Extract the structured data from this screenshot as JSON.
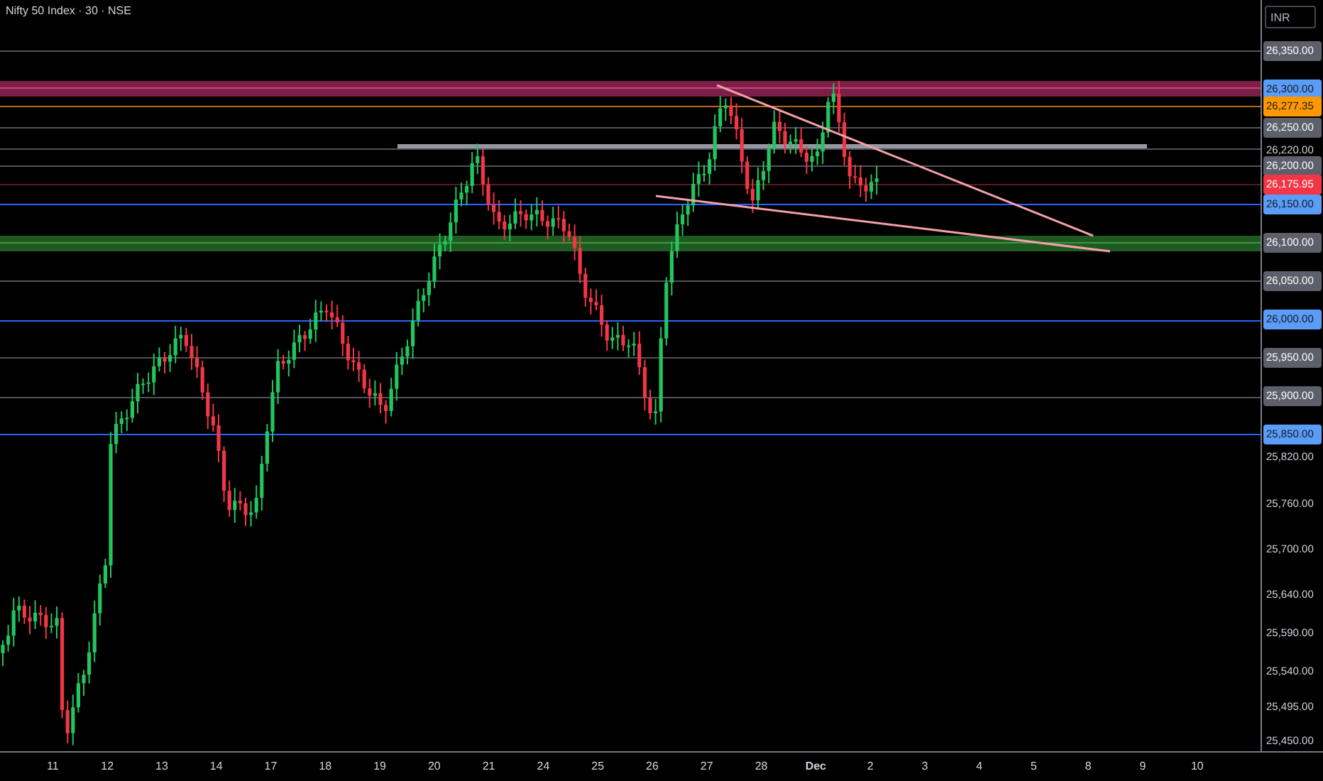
{
  "chart_header": {
    "title": "Nifty 50 Index · 30 · NSE"
  },
  "price_axis": {
    "currency": "INR",
    "labels": [
      {
        "text": "26,350.00",
        "kind": "tag",
        "color": "#5d606b"
      },
      {
        "text": "26,300.00",
        "kind": "tag",
        "color": "#5b9cf6"
      },
      {
        "text": "26,277.35",
        "kind": "tag",
        "color": "#ff9800"
      },
      {
        "text": "26,250.00",
        "kind": "tag",
        "color": "#5d606b"
      },
      {
        "text": "26,220.00",
        "kind": "plain"
      },
      {
        "text": "26,200.00",
        "kind": "tag",
        "color": "#5d606b"
      },
      {
        "text": "26,175.95",
        "kind": "tag",
        "color": "#f23645"
      },
      {
        "text": "26,150.00",
        "kind": "tag",
        "color": "#5b9cf6"
      },
      {
        "text": "26,100.00",
        "kind": "tag",
        "color": "#5d606b"
      },
      {
        "text": "26,050.00",
        "kind": "tag",
        "color": "#5d606b"
      },
      {
        "text": "26,000.00",
        "kind": "tag",
        "color": "#5b9cf6"
      },
      {
        "text": "25,950.00",
        "kind": "tag",
        "color": "#5d606b"
      },
      {
        "text": "25,900.00",
        "kind": "tag",
        "color": "#5d606b"
      },
      {
        "text": "25,850.00",
        "kind": "tag",
        "color": "#5b9cf6"
      },
      {
        "text": "25,820.00",
        "kind": "plain"
      },
      {
        "text": "25,760.00",
        "kind": "plain"
      },
      {
        "text": "25,700.00",
        "kind": "plain"
      },
      {
        "text": "25,640.00",
        "kind": "plain"
      },
      {
        "text": "25,590.00",
        "kind": "plain"
      },
      {
        "text": "25,540.00",
        "kind": "plain"
      },
      {
        "text": "25,495.00",
        "kind": "plain"
      },
      {
        "text": "25,450.00",
        "kind": "plain"
      }
    ]
  },
  "time_axis": {
    "labels": [
      {
        "text": "11",
        "kind": "day"
      },
      {
        "text": "12",
        "kind": "day"
      },
      {
        "text": "13",
        "kind": "day"
      },
      {
        "text": "14",
        "kind": "day"
      },
      {
        "text": "17",
        "kind": "day"
      },
      {
        "text": "18",
        "kind": "day"
      },
      {
        "text": "19",
        "kind": "day"
      },
      {
        "text": "20",
        "kind": "day"
      },
      {
        "text": "21",
        "kind": "day"
      },
      {
        "text": "24",
        "kind": "day"
      },
      {
        "text": "25",
        "kind": "day"
      },
      {
        "text": "26",
        "kind": "day"
      },
      {
        "text": "27",
        "kind": "day"
      },
      {
        "text": "28",
        "kind": "day"
      },
      {
        "text": "Dec",
        "kind": "month"
      },
      {
        "text": "2",
        "kind": "day"
      },
      {
        "text": "3",
        "kind": "day"
      },
      {
        "text": "4",
        "kind": "day"
      },
      {
        "text": "5",
        "kind": "day"
      },
      {
        "text": "8",
        "kind": "day"
      },
      {
        "text": "9",
        "kind": "day"
      },
      {
        "text": "10",
        "kind": "day"
      }
    ]
  }
}
